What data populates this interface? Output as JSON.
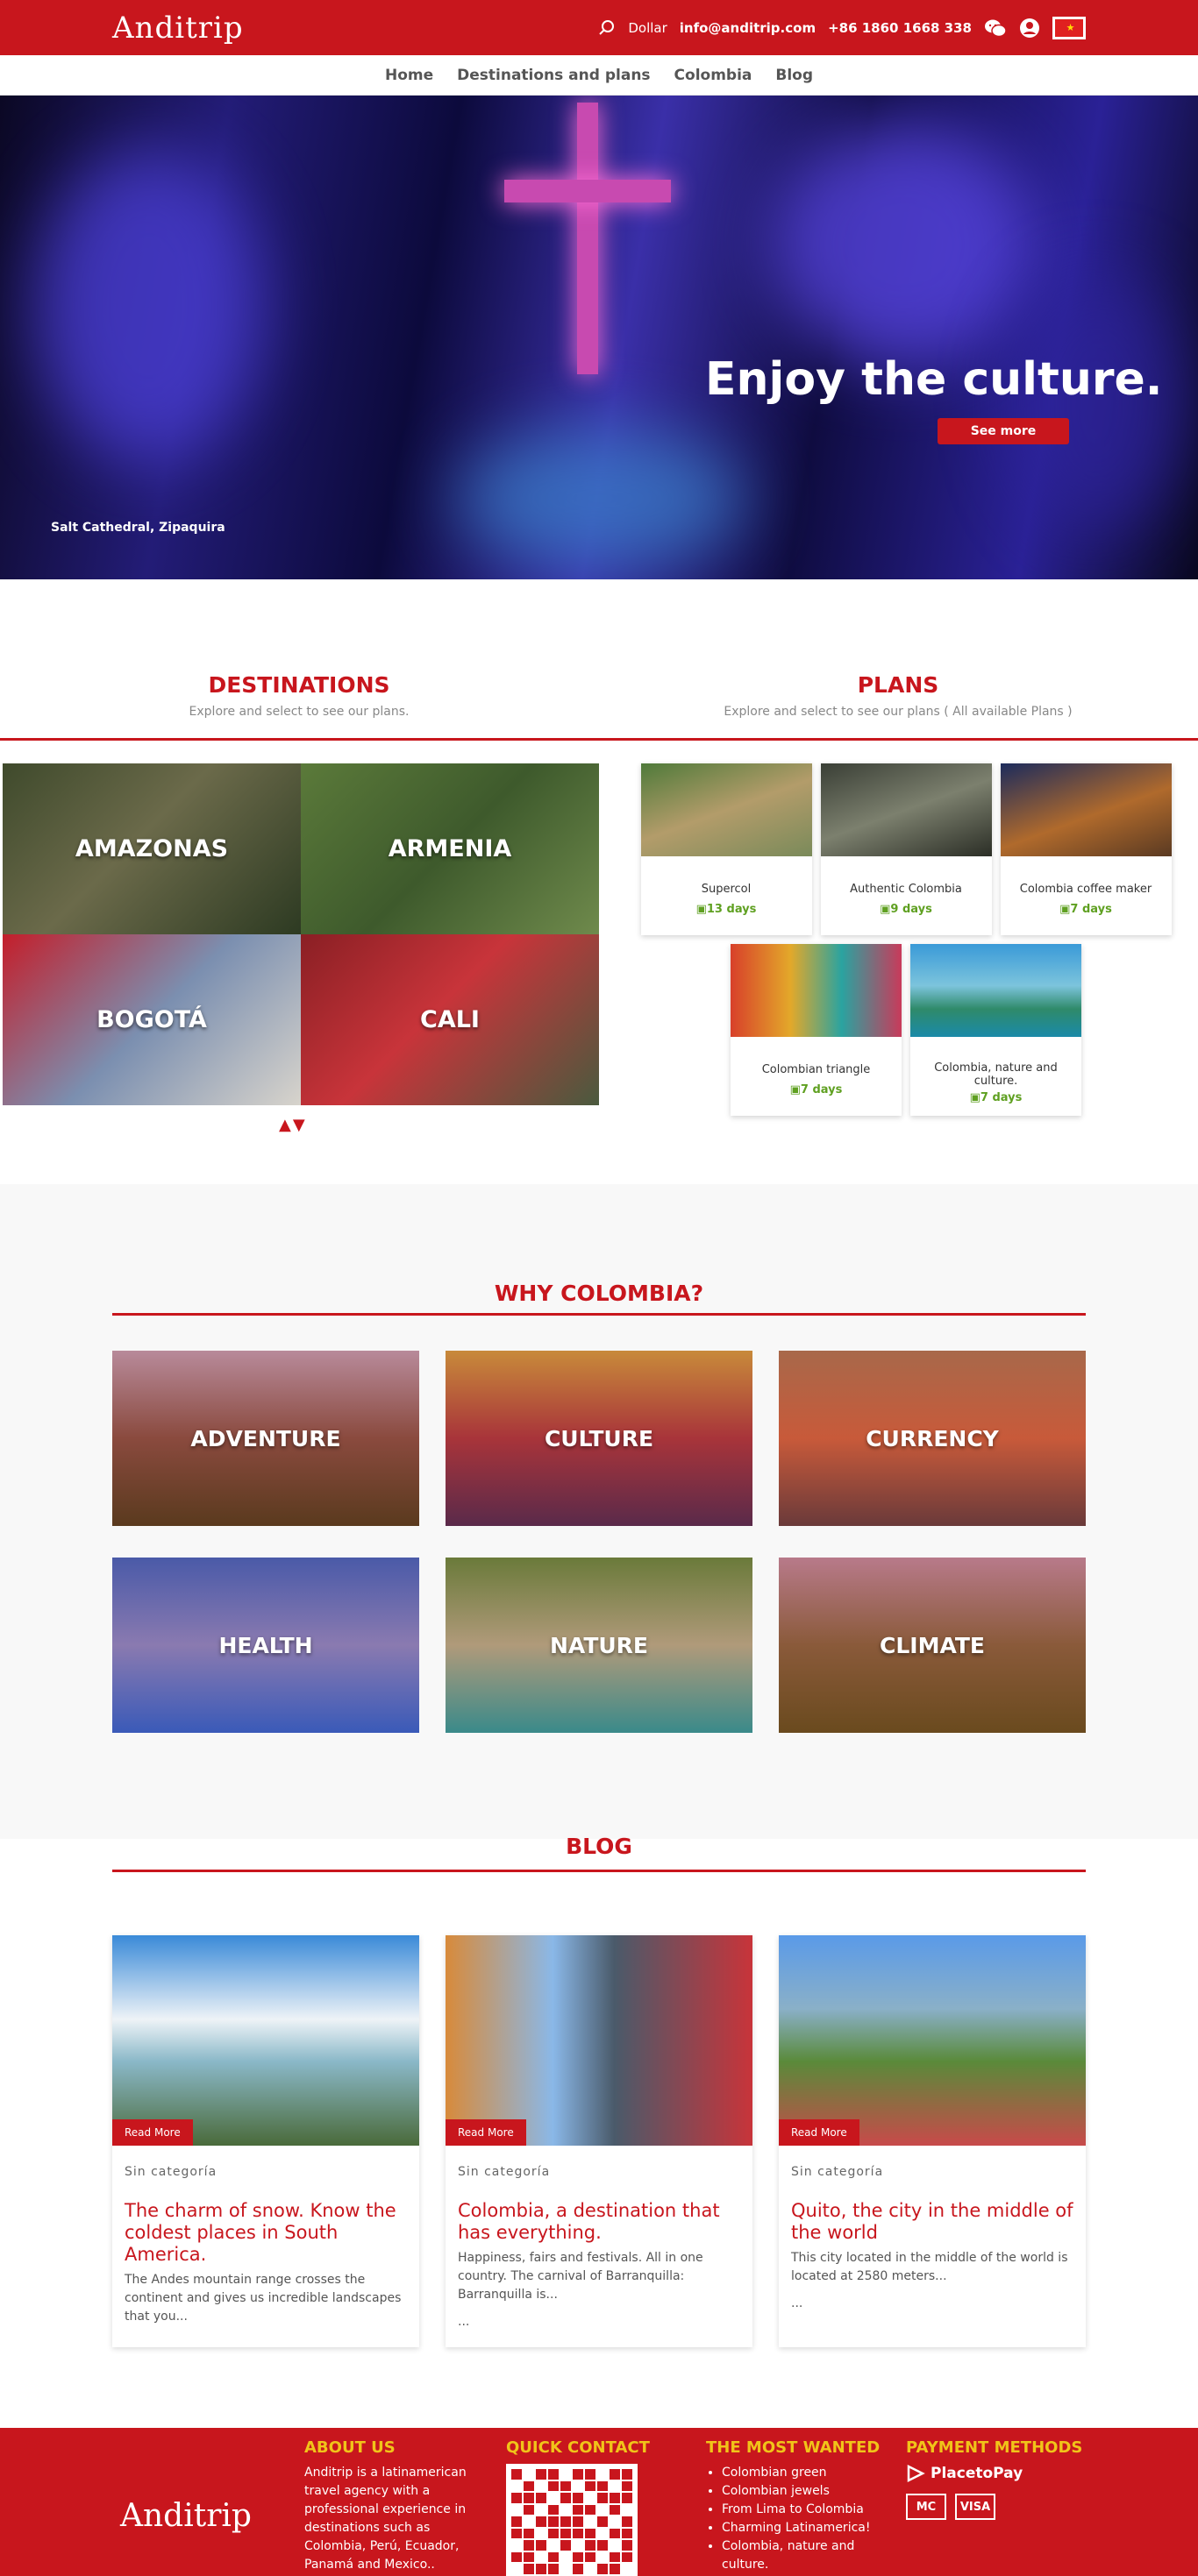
{
  "header": {
    "logo": "Anditrip",
    "currency": "Dollar",
    "email": "info@anditrip.com",
    "phone": "+86 1860 1668 338",
    "flag_icon": "china-flag-icon",
    "flag_glyph": "★",
    "accent_color": "#c8161d"
  },
  "nav": {
    "items": [
      "Home",
      "Destinations and plans",
      "Colombia",
      "Blog"
    ]
  },
  "hero": {
    "title": "Enjoy the culture.",
    "button": "See more",
    "caption": "Salt Cathedral, Zipaquira"
  },
  "destinations": {
    "title": "DESTINATIONS",
    "subtitle": "Explore and select to see our plans.",
    "items": [
      "AMAZONAS",
      "ARMENIA",
      "BOGOTÁ",
      "CALI"
    ]
  },
  "plans": {
    "title": "PLANS",
    "subtitle": "Explore and select to see our plans ( All available Plans )",
    "items": [
      {
        "name": "Supercol",
        "days": "13 days"
      },
      {
        "name": "Authentic Colombia",
        "days": "9 days"
      },
      {
        "name": "Colombia coffee maker",
        "days": "7 days"
      },
      {
        "name": "Colombian triangle",
        "days": "7 days"
      },
      {
        "name": "Colombia, nature and culture.",
        "days": "7 days"
      }
    ]
  },
  "why": {
    "title": "WHY COLOMBIA?",
    "items": [
      "ADVENTURE",
      "CULTURE",
      "CURRENCY",
      "HEALTH",
      "NATURE",
      "CLIMATE"
    ]
  },
  "blog": {
    "title": "BLOG",
    "read_more": "Read More",
    "posts": [
      {
        "category": "Sin categoría",
        "title": "The charm of snow. Know the coldest places in South America.",
        "excerpt": "The Andes mountain range crosses the continent and gives us incredible landscapes that you...",
        "more": ""
      },
      {
        "category": "Sin categoría",
        "title": "Colombia, a destination that has everything.",
        "excerpt": "Happiness, fairs and festivals. All in one country. The carnival of Barranquilla: Barranquilla is...",
        "more": "..."
      },
      {
        "category": "Sin categoría",
        "title": "Quito, the city in the middle of the world",
        "excerpt": "This city located in the middle of the world is located at 2580 meters...",
        "more": "..."
      }
    ]
  },
  "footer": {
    "logo": "Anditrip",
    "about_title": "ABOUT US",
    "about_text": "Anditrip is a latinamerican travel agency with a professional experience in destinations such as Colombia, Perú, Ecuador, Panamá and Mexico..",
    "contact_title": "QUICK CONTACT",
    "wanted_title": "THE MOST WANTED",
    "wanted_items": [
      "Colombian green",
      "Colombian jewels",
      "From Lima to Colombia",
      "Charming Latinamerica!",
      "Colombia, nature and culture."
    ],
    "payment_title": "PAYMENT METHODS",
    "payment_provider": "PlacetoPay",
    "card1": "MC",
    "card2": "VISA"
  }
}
